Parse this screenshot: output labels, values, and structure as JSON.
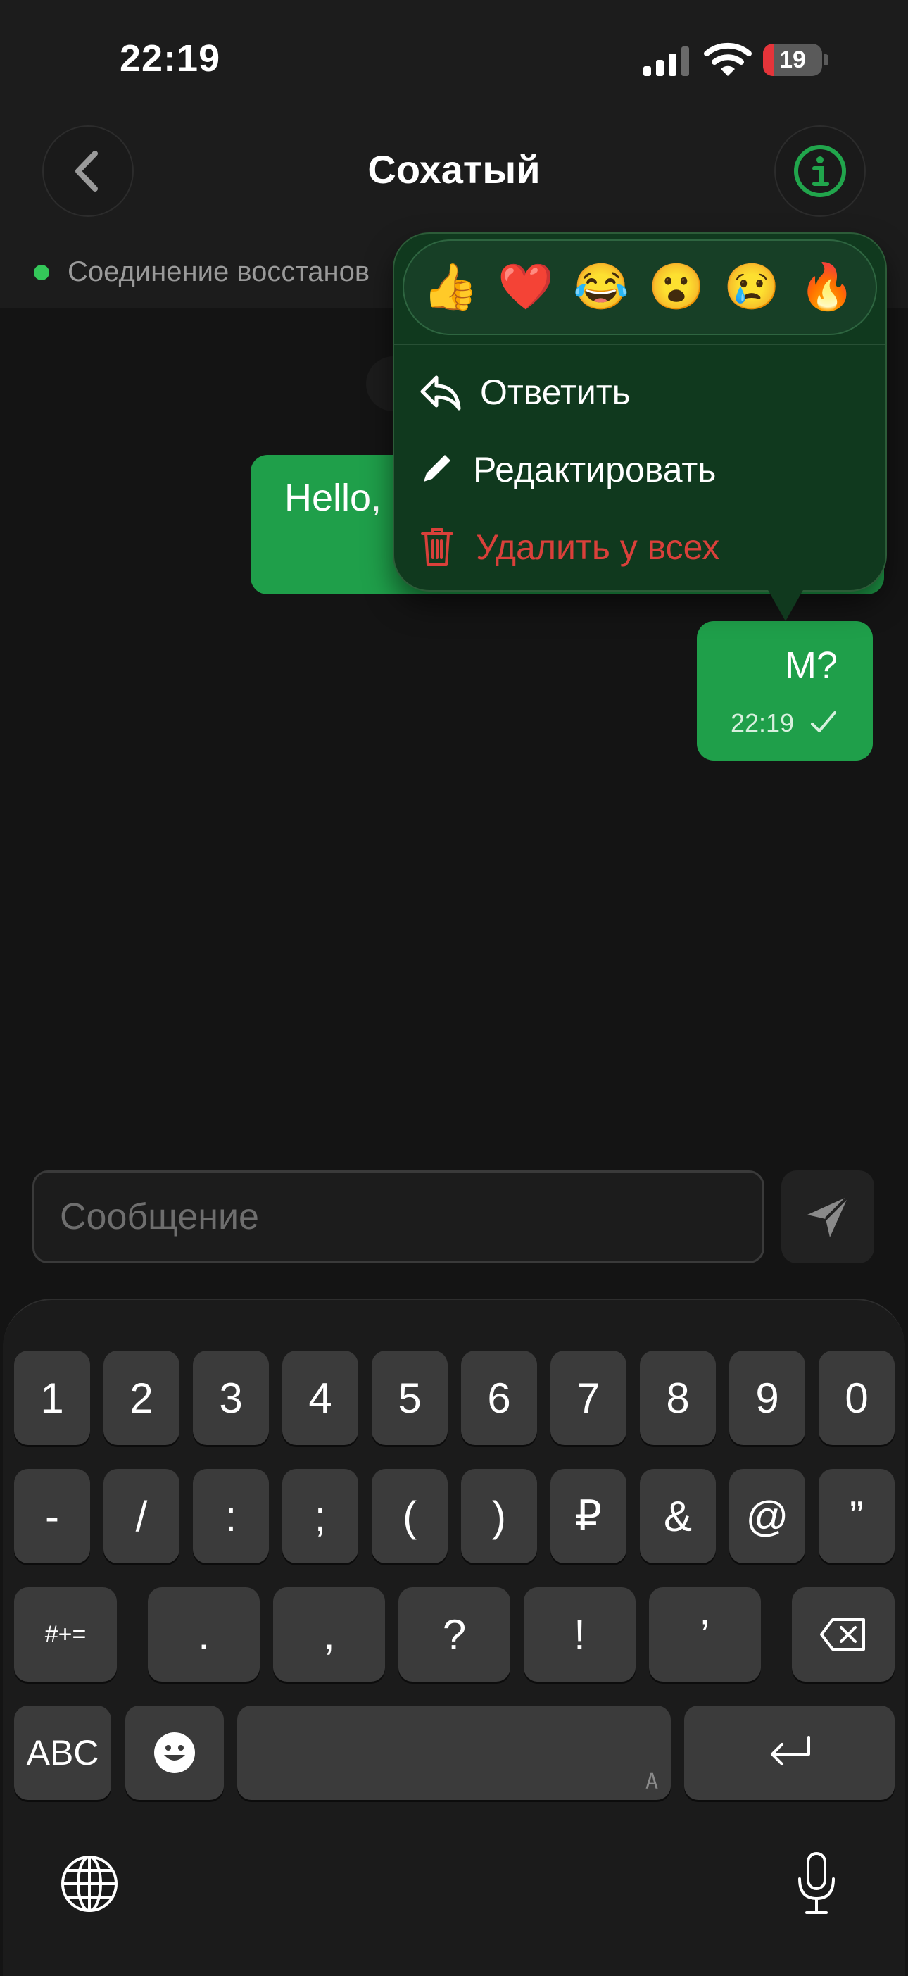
{
  "status_bar": {
    "time": "22:19",
    "battery_level": "19",
    "battery_fraction": 0.19
  },
  "header": {
    "title": "Сохатый",
    "back_icon": "chevron-left-icon",
    "info_icon": "info-icon"
  },
  "connection": {
    "status_text": "Соединение восстанов",
    "dot_color": "#34c759"
  },
  "messages": [
    {
      "text": "Hello,",
      "outgoing": true
    },
    {
      "text": "M?",
      "time": "22:19",
      "status": "sent",
      "outgoing": true
    }
  ],
  "context_menu": {
    "reactions": [
      "👍",
      "❤️",
      "😂",
      "😮",
      "😢",
      "🔥"
    ],
    "items": [
      {
        "label": "Ответить",
        "icon": "reply-icon",
        "color": "#ffffff"
      },
      {
        "label": "Редактировать",
        "icon": "pencil-icon",
        "color": "#ffffff"
      },
      {
        "label": "Удалить у всех",
        "icon": "trash-icon",
        "color": "#d9403a"
      }
    ]
  },
  "composer": {
    "placeholder": "Сообщение",
    "send_icon": "send-icon"
  },
  "keyboard": {
    "row1": [
      "1",
      "2",
      "3",
      "4",
      "5",
      "6",
      "7",
      "8",
      "9",
      "0"
    ],
    "row2": [
      "-",
      "/",
      ":",
      ";",
      "(",
      ")",
      "₽",
      "&",
      "@",
      "”"
    ],
    "row3": [
      "#+=",
      ".",
      ",",
      "?",
      "!",
      "’"
    ],
    "row4": {
      "abc": "ABC",
      "space_hint": "A"
    },
    "icons": [
      "backspace-icon",
      "emoji-icon",
      "return-icon",
      "globe-icon",
      "microphone-icon"
    ]
  },
  "colors": {
    "accent": "#1f9f4a",
    "danger": "#d9403a",
    "background": "#141414"
  }
}
